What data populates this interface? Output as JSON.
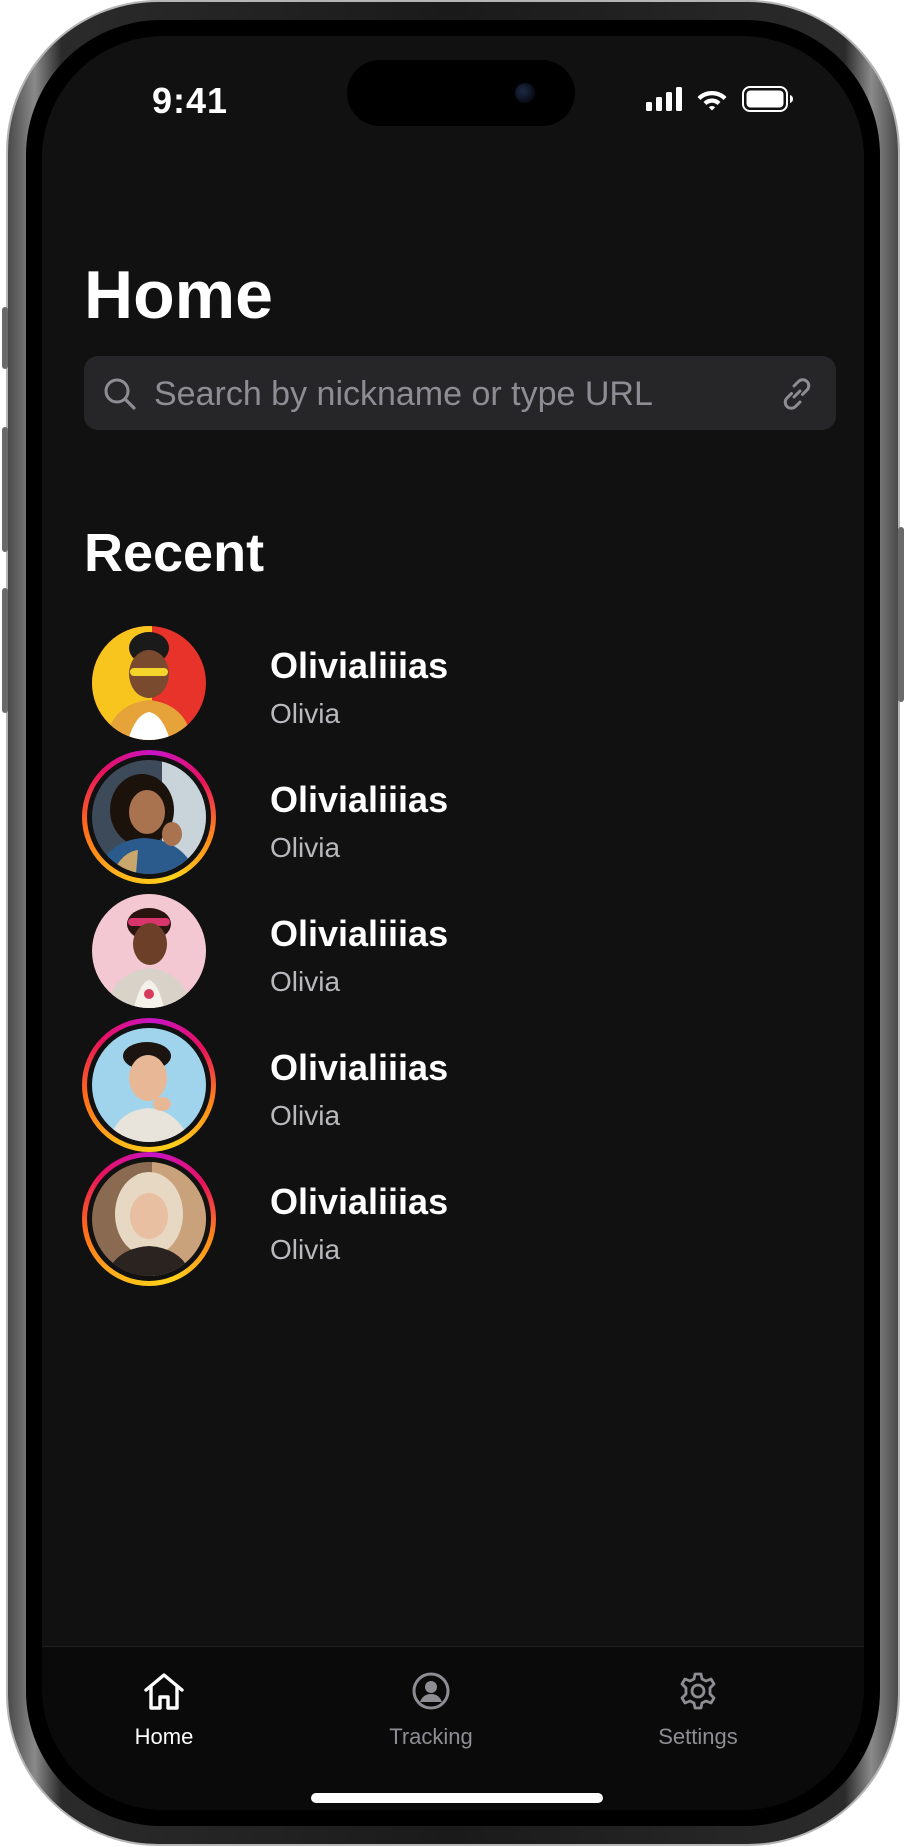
{
  "status_bar": {
    "time": "9:41",
    "icons": [
      "cellular-signal-icon",
      "wifi-icon",
      "battery-icon"
    ]
  },
  "header": {
    "title": "Home"
  },
  "search": {
    "placeholder": "Search by nickname or type URL",
    "value": "",
    "leading_icon": "search-icon",
    "trailing_icon": "link-icon"
  },
  "recent": {
    "title": "Recent",
    "items": [
      {
        "nickname": "Olivialiiias",
        "name": "Olivia",
        "has_story_ring": false,
        "avatar_colors": [
          "#f7c51e",
          "#e8332b"
        ]
      },
      {
        "nickname": "Olivialiiias",
        "name": "Olivia",
        "has_story_ring": true,
        "avatar_colors": [
          "#2b5a8c",
          "#c9a66b"
        ]
      },
      {
        "nickname": "Olivialiiias",
        "name": "Olivia",
        "has_story_ring": false,
        "avatar_colors": [
          "#f4c8d2",
          "#e9a9b7"
        ]
      },
      {
        "nickname": "Olivialiiias",
        "name": "Olivia",
        "has_story_ring": true,
        "avatar_colors": [
          "#9fd4ec",
          "#6fb8d9"
        ]
      },
      {
        "nickname": "Olivialiiias",
        "name": "Olivia",
        "has_story_ring": true,
        "avatar_colors": [
          "#d9c9b4",
          "#8a6a50"
        ]
      }
    ]
  },
  "tab_bar": {
    "tabs": [
      {
        "label": "Home",
        "icon": "home-icon",
        "active": true
      },
      {
        "label": "Tracking",
        "icon": "person-circle-icon",
        "active": false
      },
      {
        "label": "Settings",
        "icon": "gear-icon",
        "active": false
      }
    ]
  },
  "colors": {
    "background": "#111111",
    "search_field": "#262628",
    "secondary_text": "#b9b9bd",
    "inactive_tab": "#8d8d93",
    "story_ring": [
      "#ffb31a",
      "#e8125c",
      "#c813c8"
    ]
  }
}
